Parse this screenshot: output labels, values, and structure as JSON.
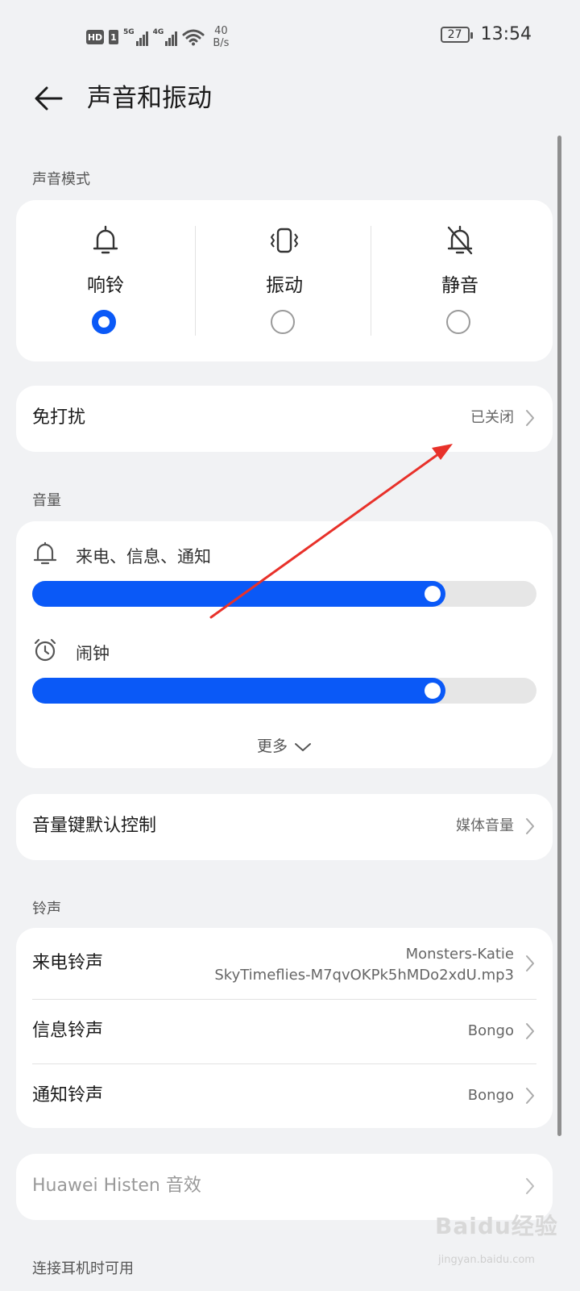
{
  "status_bar": {
    "hd_badge": "HD",
    "sim_badge": "1",
    "net1": "5G",
    "net2": "4G",
    "speed_value": "40",
    "speed_unit": "B/s",
    "battery": "27",
    "time": "13:54"
  },
  "header": {
    "title": "声音和振动"
  },
  "sound_mode": {
    "section_label": "声音模式",
    "modes": [
      {
        "label": "响铃",
        "icon": "bell-icon",
        "selected": true
      },
      {
        "label": "振动",
        "icon": "vibrate-icon",
        "selected": false
      },
      {
        "label": "静音",
        "icon": "bell-off-icon",
        "selected": false
      }
    ]
  },
  "dnd": {
    "label": "免打扰",
    "value": "已关闭"
  },
  "volume": {
    "section_label": "音量",
    "items": [
      {
        "label": "来电、信息、通知",
        "icon": "bell-icon",
        "level_fraction": 0.82
      },
      {
        "label": "闹钟",
        "icon": "alarm-clock-icon",
        "level_fraction": 0.82
      }
    ],
    "more_label": "更多"
  },
  "volume_key": {
    "label": "音量键默认控制",
    "value": "媒体音量"
  },
  "ringtones": {
    "section_label": "铃声",
    "items": [
      {
        "label": "来电铃声",
        "value_line1": "Monsters-Katie",
        "value_line2": "SkyTimeflies-M7qvOKPk5hMDo2xdU.mp3"
      },
      {
        "label": "信息铃声",
        "value": "Bongo"
      },
      {
        "label": "通知铃声",
        "value": "Bongo"
      }
    ]
  },
  "histen": {
    "label": "Huawei Histen 音效"
  },
  "headset_section": {
    "label": "连接耳机时可用"
  },
  "watermark": {
    "brand": "Baidu经验",
    "sub": "jingyan.baidu.com"
  },
  "colors": {
    "accent": "#0a59f7",
    "background": "#f1f2f4",
    "card": "#ffffff",
    "annotation_arrow": "#e8312a"
  }
}
